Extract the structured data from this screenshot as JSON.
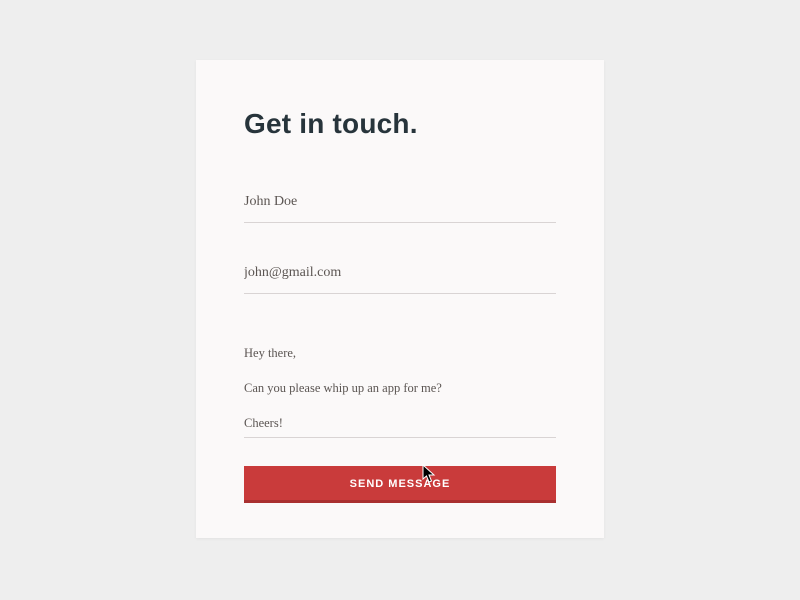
{
  "form": {
    "title": "Get in touch.",
    "name_value": "John Doe",
    "email_value": "john@gmail.com",
    "message_value": "Hey there,\nCan you please whip up an app for me?\nCheers!",
    "submit_label": "SEND MESSAGE"
  },
  "colors": {
    "accent": "#c93b3b",
    "card_bg": "#fbf9f9",
    "page_bg": "#eeeeee",
    "title": "#27343b"
  }
}
